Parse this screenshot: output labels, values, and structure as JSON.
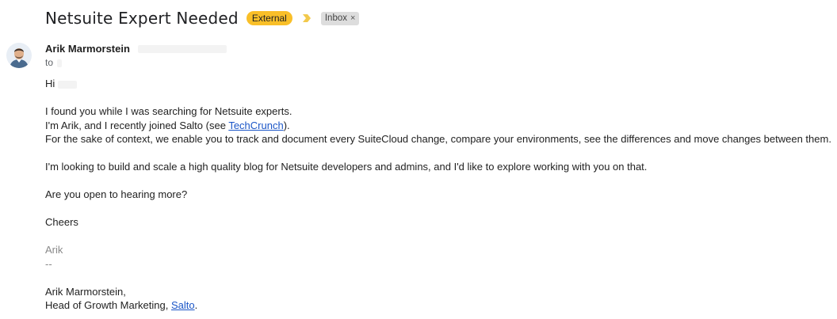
{
  "header": {
    "subject": "Netsuite Expert Needed",
    "labels": [
      {
        "text": "External",
        "color": "#f9bf28"
      },
      {
        "text": "Inbox",
        "color": "#dddddd"
      }
    ],
    "inbox_close": "×"
  },
  "message": {
    "sender_name": "Arik Marmorstein",
    "to_prefix": "to",
    "greeting": "Hi",
    "lines": {
      "l1": "I found you while I was searching for Netsuite experts.",
      "l2_pre": "I'm Arik, and I recently joined Salto (see ",
      "l2_link": "TechCrunch",
      "l2_post": ").",
      "l3": "For the sake of context, we enable you to track and document every SuiteCloud change, compare your environments, see the differences and move changes between them.",
      "l4": "I'm looking to build and scale a high quality blog for Netsuite developers and admins, and I'd like to explore working with you on that.",
      "l5": "Are you open to hearing more?",
      "l6": "Cheers",
      "sig_name": "Arik",
      "sig_sep": "--",
      "sig_full": "Arik Marmorstein,",
      "sig_title_pre": "Head of Growth Marketing, ",
      "sig_link": "Salto",
      "sig_title_post": "."
    }
  },
  "colors": {
    "link": "#1a55c7",
    "external_label": "#f9bf28",
    "importance_marker": "#f2c94c"
  }
}
